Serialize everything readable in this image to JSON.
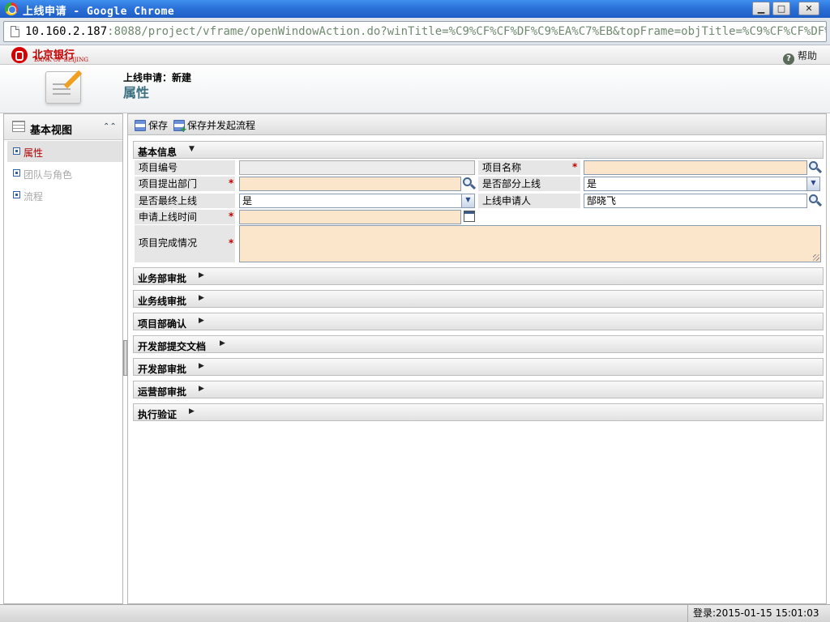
{
  "window": {
    "title": "上线申请 - Google Chrome",
    "minimize_label": "▁",
    "maximize_label": "□",
    "close_label": "✕"
  },
  "address": {
    "host": "10.160.2.187",
    "rest": ":8088/project/vframe/openWindowAction.do?winTitle=%C9%CF%CF%DF%C9%EA%C7%EB&topFrame=objTitle=%C9%CF%CF%DF%C9%EA%"
  },
  "header": {
    "logo_cn": "北京银行",
    "logo_en": "BANK OF BEIJING",
    "help_label": "帮助"
  },
  "titlearea": {
    "subtitle": "上线申请：新建",
    "title": "属性"
  },
  "sidebar": {
    "title": "基本视图",
    "items": [
      {
        "label": "属性",
        "state": "active"
      },
      {
        "label": "团队与角色",
        "state": "disabled"
      },
      {
        "label": "流程",
        "state": "disabled"
      }
    ]
  },
  "toolbar": {
    "save_label": "保存",
    "save_start_label": "保存并发起流程"
  },
  "basic_section": {
    "title": "基本信息",
    "fields": {
      "project_no": {
        "label": "项目编号",
        "value": ""
      },
      "project_name": {
        "label": "项目名称",
        "value": ""
      },
      "dept": {
        "label": "项目提出部门",
        "value": ""
      },
      "partial": {
        "label": "是否部分上线",
        "value": "是"
      },
      "final": {
        "label": "是否最终上线",
        "value": "是"
      },
      "applicant": {
        "label": "上线申请人",
        "value": "郜晓飞"
      },
      "apply_time": {
        "label": "申请上线时间",
        "value": ""
      },
      "completion": {
        "label": "项目完成情况",
        "value": ""
      }
    },
    "required_mark": "*"
  },
  "collapsed_sections": [
    "业务部审批",
    "业务线审批",
    "项目部确认",
    "开发部提交文档",
    "开发部审批",
    "运营部审批",
    "执行验证"
  ],
  "status": {
    "login_text": "登录:2015-01-15 15:01:03"
  },
  "colors": {
    "required_bg": "#fbe6cc",
    "required_mark": "#c00000",
    "active_nav": "#b00000"
  }
}
